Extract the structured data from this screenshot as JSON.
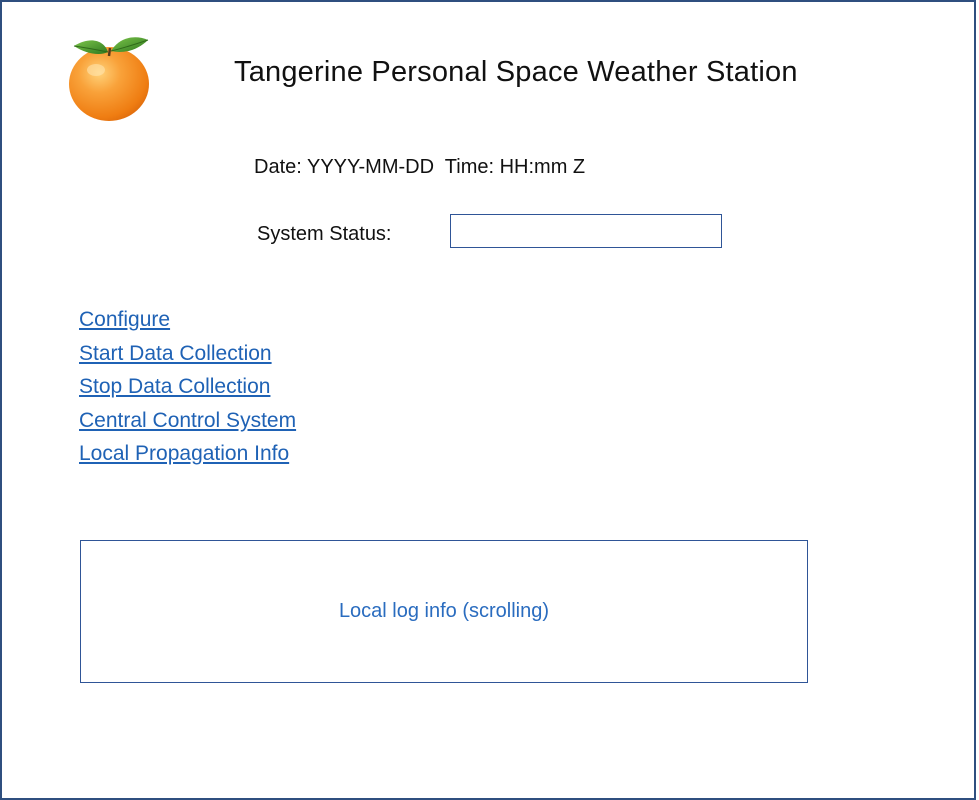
{
  "header": {
    "title": "Tangerine Personal Space Weather Station",
    "logo_icon": "tangerine-icon"
  },
  "clock": {
    "text": "Date: YYYY-MM-DD  Time: HH:mm Z"
  },
  "status": {
    "label": "System Status:",
    "value": ""
  },
  "nav": {
    "links": [
      "Configure",
      "Start Data Collection",
      "Stop Data Collection",
      "Central Control System",
      "Local Propagation Info"
    ]
  },
  "log": {
    "text": "Local log info (scrolling)"
  },
  "colors": {
    "border": "#2f5597",
    "link": "#1f62b5",
    "frame": "#2f4f7f",
    "orange": "#f58a1f",
    "leaf": "#4a9a2a"
  }
}
